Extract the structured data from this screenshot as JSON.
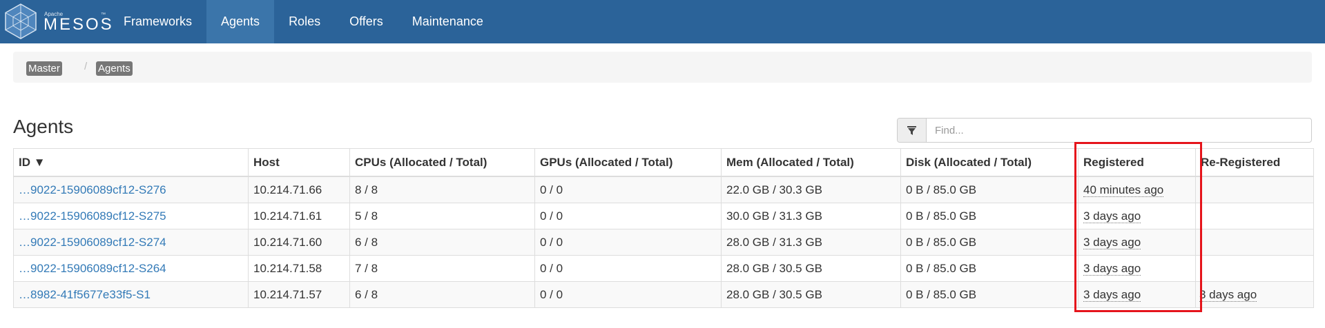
{
  "brand": {
    "small": "Apache",
    "name": "MESOS",
    "tm": "™"
  },
  "nav": [
    {
      "label": "Frameworks",
      "active": false
    },
    {
      "label": "Agents",
      "active": true
    },
    {
      "label": "Roles",
      "active": false
    },
    {
      "label": "Offers",
      "active": false
    },
    {
      "label": "Maintenance",
      "active": false
    }
  ],
  "breadcrumb": {
    "items": [
      "Master",
      "Agents"
    ],
    "separator": "/"
  },
  "page": {
    "title": "Agents"
  },
  "filter": {
    "placeholder": "Find...",
    "value": ""
  },
  "table": {
    "headers": {
      "id": "ID ▼",
      "host": "Host",
      "cpus": "CPUs (Allocated / Total)",
      "gpus": "GPUs (Allocated / Total)",
      "mem": "Mem (Allocated / Total)",
      "disk": "Disk (Allocated / Total)",
      "registered": "Registered",
      "reregistered": "Re-Registered"
    },
    "rows": [
      {
        "id": "…9022-15906089cf12-S276",
        "host": "10.214.71.66",
        "cpus": "8 / 8",
        "gpus": "0 / 0",
        "mem": "22.0 GB / 30.3 GB",
        "disk": "0 B / 85.0 GB",
        "registered": "40 minutes ago",
        "reregistered": ""
      },
      {
        "id": "…9022-15906089cf12-S275",
        "host": "10.214.71.61",
        "cpus": "5 / 8",
        "gpus": "0 / 0",
        "mem": "30.0 GB / 31.3 GB",
        "disk": "0 B / 85.0 GB",
        "registered": "3 days ago",
        "reregistered": ""
      },
      {
        "id": "…9022-15906089cf12-S274",
        "host": "10.214.71.60",
        "cpus": "6 / 8",
        "gpus": "0 / 0",
        "mem": "28.0 GB / 31.3 GB",
        "disk": "0 B / 85.0 GB",
        "registered": "3 days ago",
        "reregistered": ""
      },
      {
        "id": "…9022-15906089cf12-S264",
        "host": "10.214.71.58",
        "cpus": "7 / 8",
        "gpus": "0 / 0",
        "mem": "28.0 GB / 30.5 GB",
        "disk": "0 B / 85.0 GB",
        "registered": "3 days ago",
        "reregistered": ""
      },
      {
        "id": "…8982-41f5677e33f5-S1",
        "host": "10.214.71.57",
        "cpus": "6 / 8",
        "gpus": "0 / 0",
        "mem": "28.0 GB / 30.5 GB",
        "disk": "0 B / 85.0 GB",
        "registered": "3 days ago",
        "reregistered": "3 days ago"
      }
    ]
  },
  "colors": {
    "navbar": "#2b6399",
    "nav_active": "#3b75aa",
    "link": "#337ab7",
    "highlight_box": "#e5141b",
    "crumb_badge": "#777777"
  },
  "icons": {
    "filter": "filter-icon",
    "logo": "mesos-logo-icon"
  }
}
